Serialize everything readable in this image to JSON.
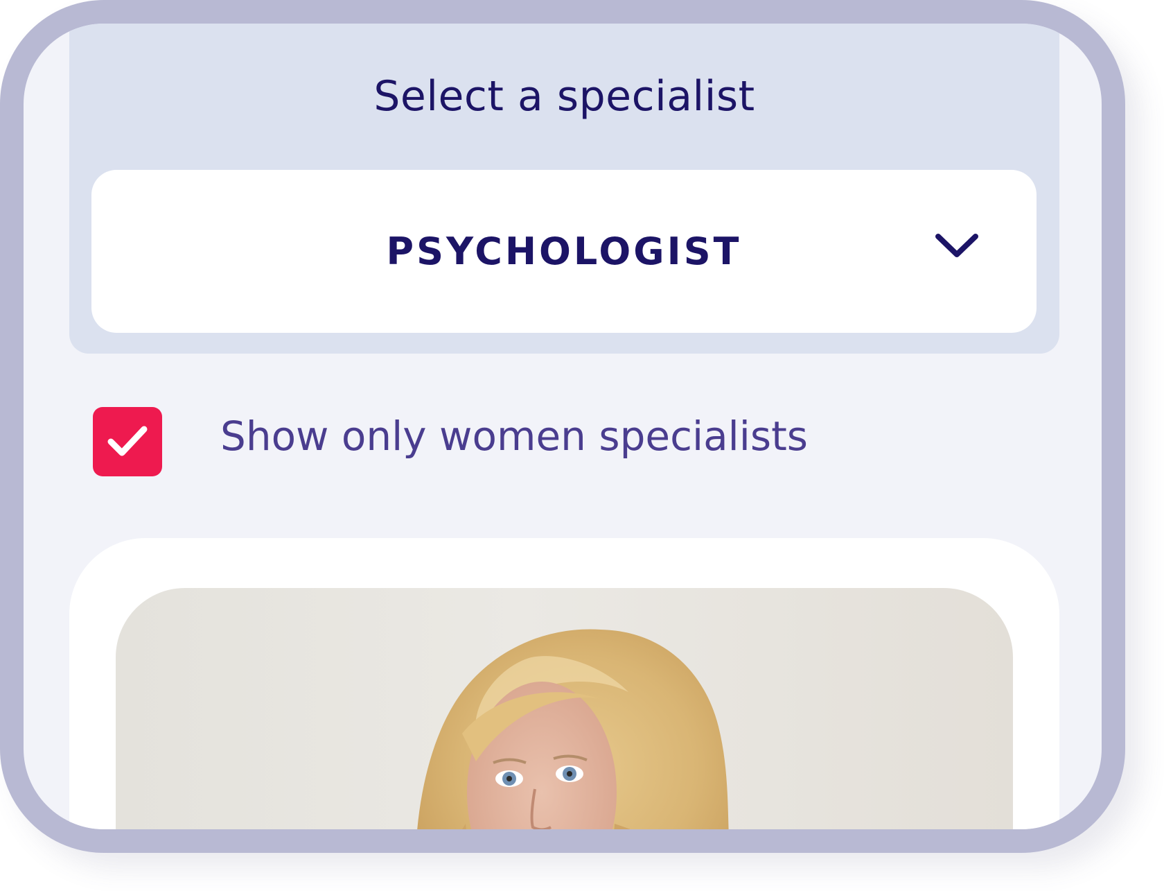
{
  "screen": {
    "title": "Select a specialist"
  },
  "specialty_select": {
    "selected_value": "PSYCHOLOGIST",
    "icon": "chevron-down-icon"
  },
  "filter": {
    "label": "Show only women specialists",
    "checked": true,
    "icon": "checkmark-icon"
  },
  "specialist_card": {
    "photo": "specialist-photo"
  },
  "colors": {
    "frame": "#b8b9d3",
    "header_panel": "#dbe1ef",
    "background": "#f2f3f9",
    "title_text": "#1c1466",
    "label_text": "#4a3d8f",
    "checkbox_fill": "#ee1a4f"
  }
}
